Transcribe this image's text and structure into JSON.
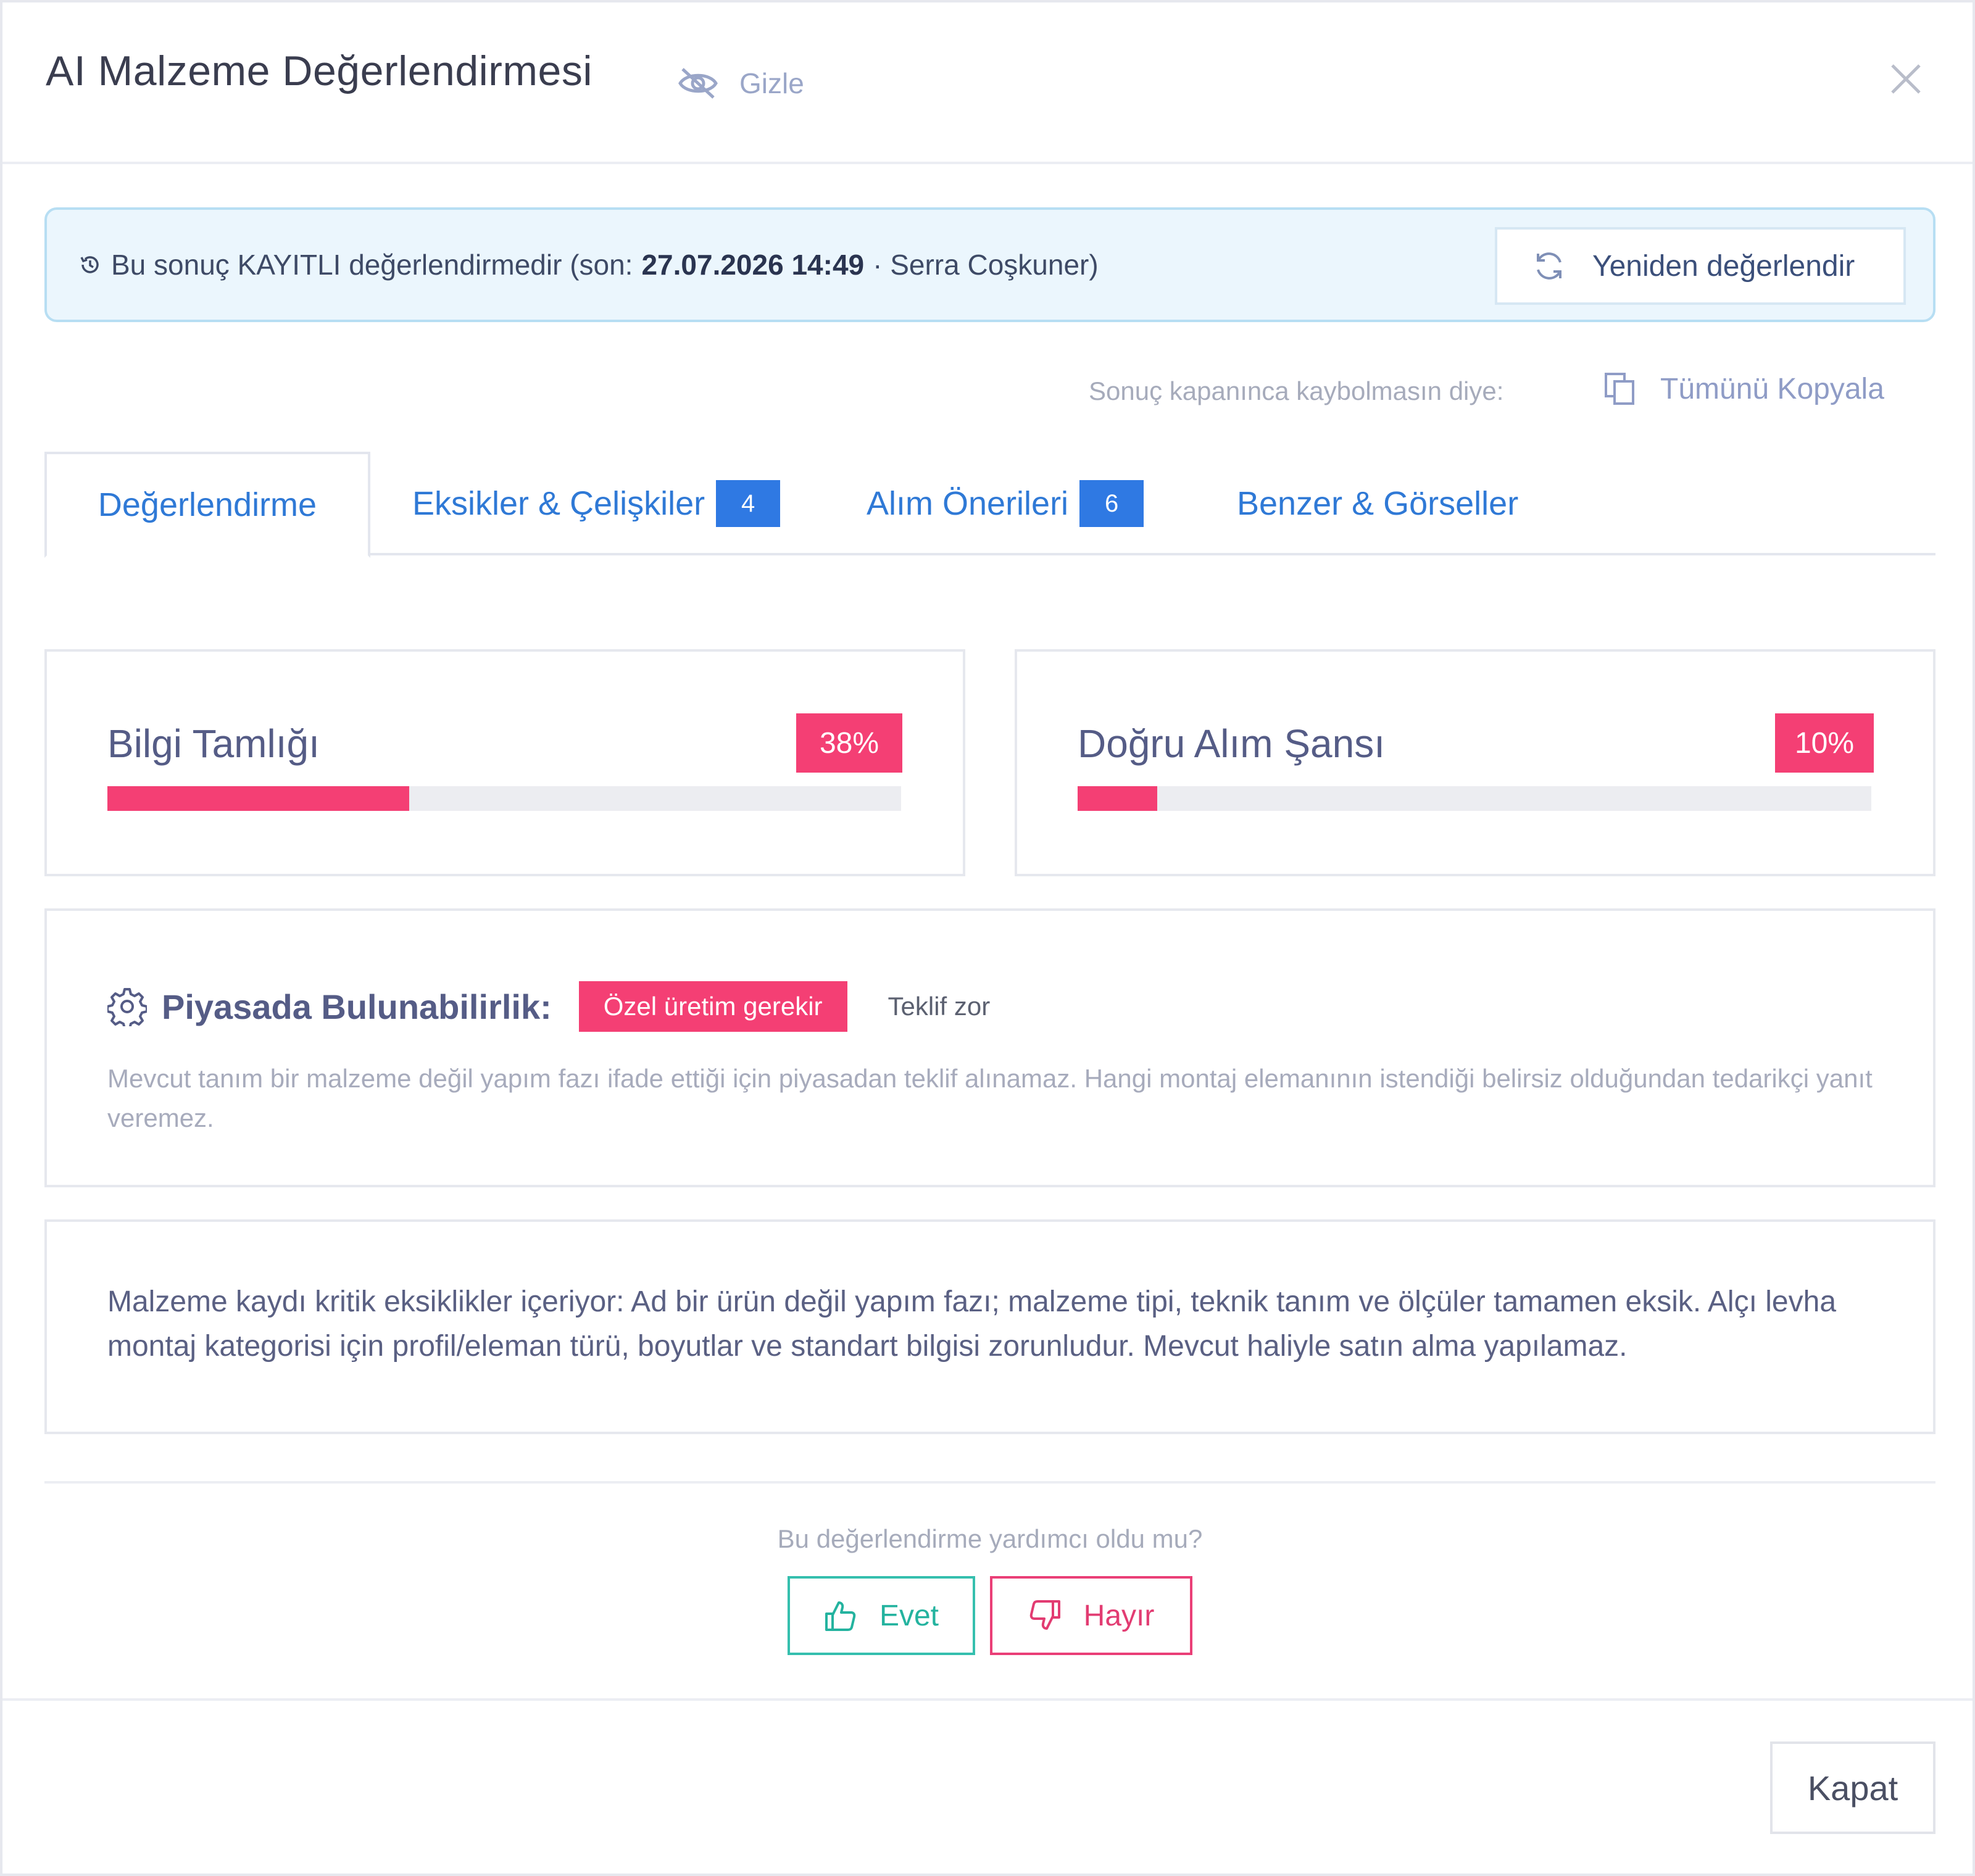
{
  "header": {
    "title": "AI Malzeme Değerlendirmesi",
    "hide_label": "Gizle",
    "icons": {
      "hide": "eye-off-icon",
      "close": "close-icon"
    }
  },
  "banner": {
    "text_before": "Bu sonuç KAYITLI değerlendirmedir (son:",
    "datetime": "27.07.2026 14:49",
    "text_after": "· Serra Coşkuner)",
    "reevaluate_label": "Yeniden değerlendir",
    "icons": {
      "history": "history-icon",
      "refresh": "refresh-icon"
    }
  },
  "copy": {
    "hint": "Sonuç kapanınca kaybolmasın diye:",
    "label": "Tümünü Kopyala",
    "icon": "copy-icon"
  },
  "tabs": [
    {
      "label": "Değerlendirme",
      "active": true
    },
    {
      "label": "Eksikler & Çelişkiler",
      "badge": "4"
    },
    {
      "label": "Alım Önerileri",
      "badge": "6"
    },
    {
      "label": "Benzer & Görseller"
    }
  ],
  "metrics": [
    {
      "title": "Bilgi Tamlığı",
      "value_label": "38%",
      "value": 0.38
    },
    {
      "title": "Doğru Alım Şansı",
      "value_label": "10%",
      "value": 0.1
    }
  ],
  "availability": {
    "icon": "gear-icon",
    "label": "Piyasada Bulunabilirlik:",
    "status": "Özel üretim gerekir",
    "sub": "Teklif zor",
    "description": "Mevcut tanım bir malzeme değil yapım fazı ifade ettiği için piyasadan teklif alınamaz. Hangi montaj elemanının istendiği belirsiz olduğundan tedarikçi yanıt veremez."
  },
  "summary": "Malzeme kaydı kritik eksiklikler içeriyor: Ad bir ürün değil yapım fazı; malzeme tipi, teknik tanım ve ölçüler tamamen eksik. Alçı levha montaj kategorisi için profil/eleman türü, boyutlar ve standart bilgisi zorunludur. Mevcut haliyle satın alma yapılamaz.",
  "feedback": {
    "question": "Bu değerlendirme yardımcı oldu mu?",
    "yes": "Evet",
    "no": "Hayır",
    "icons": {
      "yes": "thumbs-up-icon",
      "no": "thumbs-down-icon"
    }
  },
  "footer": {
    "close_label": "Kapat"
  },
  "colors": {
    "accent_blue": "#2f79d6",
    "danger_pink": "#f43f74",
    "success_teal": "#24b39f",
    "banner_bg": "#ebf6fd"
  }
}
